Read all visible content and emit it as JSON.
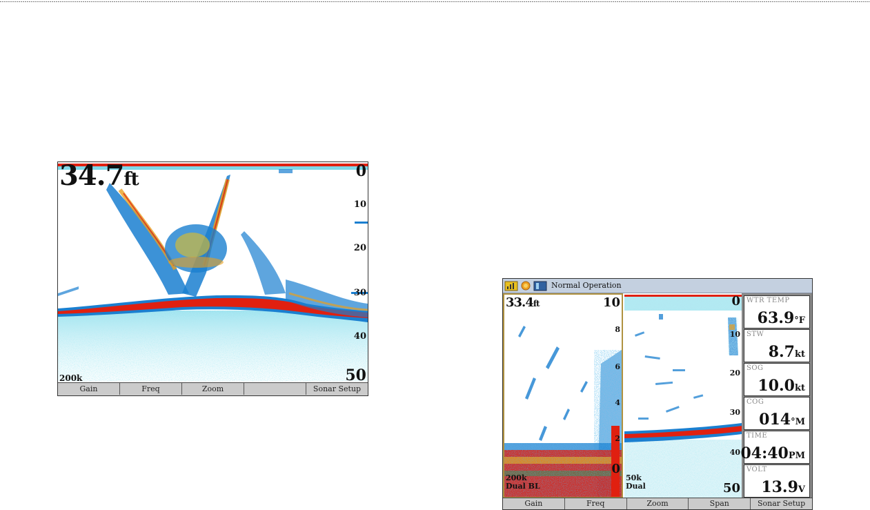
{
  "screen1": {
    "depth_value": "34.7",
    "depth_unit": "ft",
    "frequency": "200k",
    "scale": [
      "0",
      "10",
      "20",
      "30",
      "40",
      "50"
    ],
    "softkeys": [
      "Gain",
      "Freq",
      "Zoom",
      "",
      "Sonar Setup"
    ]
  },
  "screen2": {
    "status_text": "Normal Operation",
    "status_icons": [
      "gps-signal-icon",
      "sun-icon",
      "water-depth-icon"
    ],
    "flasher": {
      "depth_value": "33.4",
      "depth_unit": "ft",
      "scale": [
        "10",
        "8",
        "6",
        "4",
        "2",
        "0"
      ],
      "frequency": "200k",
      "mode": "Dual BL"
    },
    "sonar": {
      "scale": [
        "0",
        "10",
        "20",
        "30",
        "40",
        "50"
      ],
      "frequency": "50k",
      "mode": "Dual"
    },
    "data_fields": [
      {
        "label": "WTR TEMP",
        "value": "63.9",
        "unit": "°F"
      },
      {
        "label": "STW",
        "value": "8.7",
        "unit": "kt"
      },
      {
        "label": "SOG",
        "value": "10.0",
        "unit": "kt"
      },
      {
        "label": "COG",
        "value": "014",
        "unit": "°M"
      },
      {
        "label": "TIME",
        "value": "04:40",
        "unit": "PM"
      },
      {
        "label": "VOLT",
        "value": "13.9",
        "unit": "V"
      }
    ],
    "softkeys": [
      "Gain",
      "Freq",
      "Zoom",
      "Span",
      "Sonar Setup"
    ]
  },
  "colors": {
    "sonar_red": "#e02010",
    "sonar_blue": "#1a7fd0",
    "sonar_cyan": "#7fd8e8",
    "sonar_yellow": "#e8d020",
    "flasher_border": "#b09240",
    "status_bar": "#c4d0e0",
    "softkey_bg": "#cbcbcb"
  }
}
